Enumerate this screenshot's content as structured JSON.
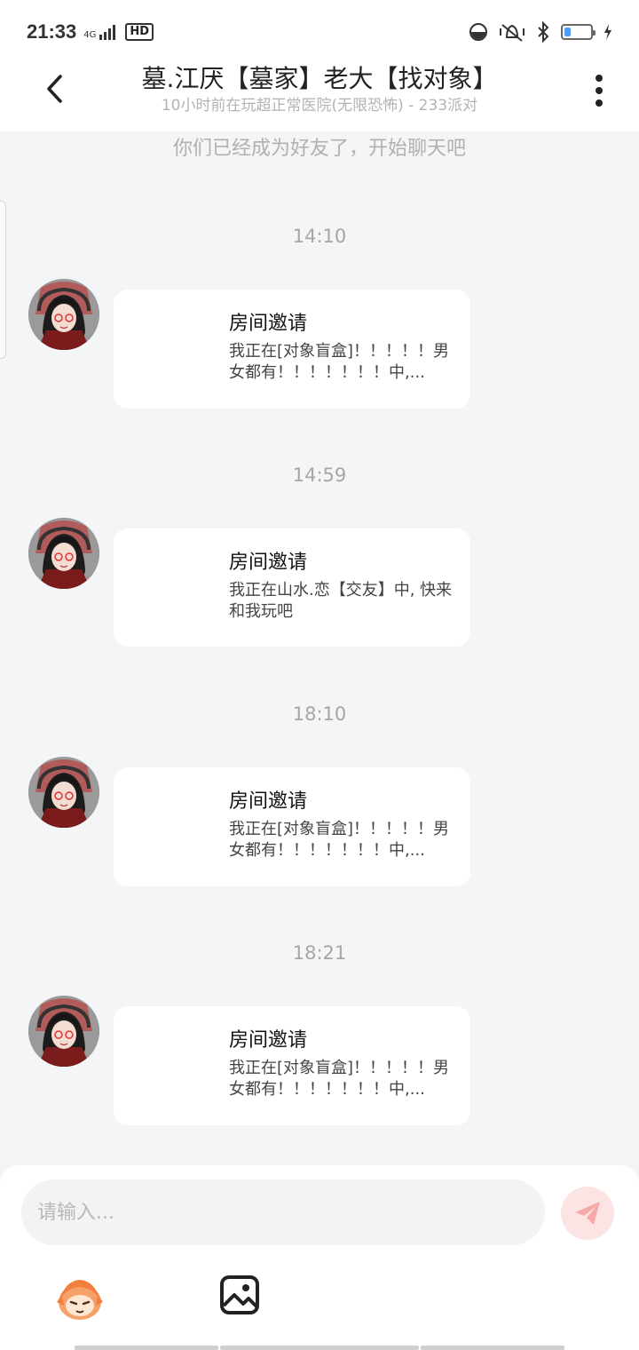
{
  "status_bar": {
    "time": "21:33",
    "network": "4G",
    "hd": "HD",
    "battery_level": 0.25,
    "colors": {
      "battery": "#4aa0ff"
    }
  },
  "header": {
    "title": "墓.江厌【墓家】老大【找对象】",
    "subtitle": "10小时前在玩超正常医院(无限恐怖) - 233派对",
    "icons": {
      "back": "chevron-left-icon",
      "more": "more-vertical-icon"
    }
  },
  "chat": {
    "notice": "你们已经成为好友了，开始聊天吧",
    "messages": [
      {
        "time": "14:10",
        "title": "房间邀请",
        "desc": "我正在[对象盲盒]！！！！！男女都有！！！！！！！中,..."
      },
      {
        "time": "14:59",
        "title": "房间邀请",
        "desc": "我正在山水.恋【交友】中, 快来和我玩吧"
      },
      {
        "time": "18:10",
        "title": "房间邀请",
        "desc": "我正在[对象盲盒]！！！！！男女都有！！！！！！！中,..."
      },
      {
        "time": "18:21",
        "title": "房间邀请",
        "desc": "我正在[对象盲盒]！！！！！男女都有！！！！！！！中,..."
      }
    ]
  },
  "composer": {
    "placeholder": "请输入...",
    "icons": {
      "send": "send-icon",
      "emoji": "emoji-face-icon",
      "image": "image-icon"
    },
    "colors": {
      "send_bg": "#fde4e4",
      "send_fg": "#f7a8a8"
    }
  }
}
